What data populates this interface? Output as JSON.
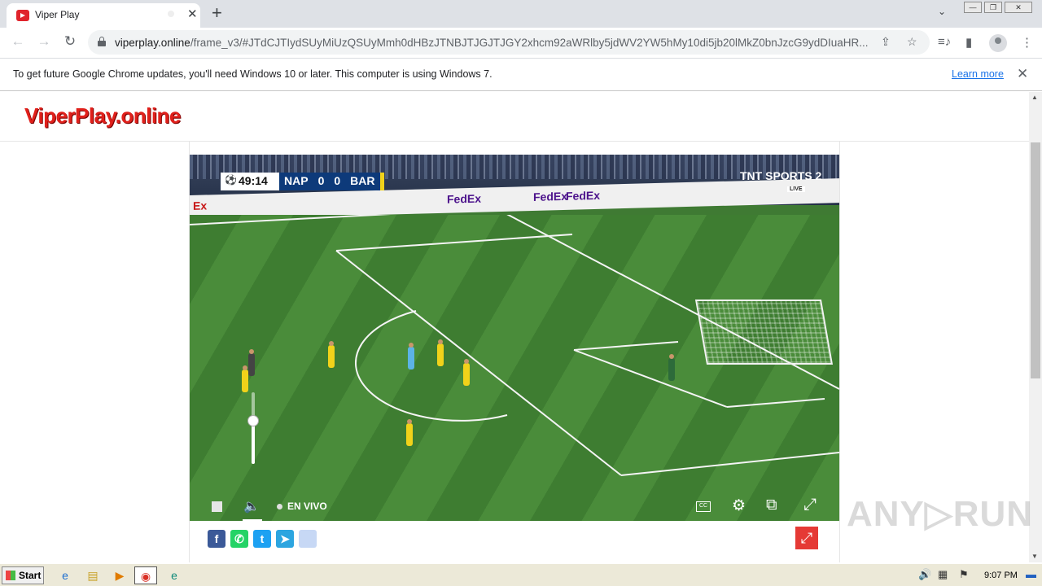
{
  "browser": {
    "tab_title": "Viper Play",
    "tab_close": "✕",
    "new_tab": "+",
    "url_host": "viperplay.online",
    "url_path": "/frame_v3/#JTdCJTIydSUyMiUzQSUyMmh0dHBzJTNBJTJGJTJGY2xhcm92aWRlby5jdWV2YW5hMy10di5jb20lMkZ0bnJzcG9ydDIuaHR...",
    "infobar_text": "To get future Google Chrome updates, you'll need Windows 10 or later. This computer is using Windows 7.",
    "infobar_link": "Learn more",
    "infobar_close": "✕",
    "back_icon": "←",
    "forward_icon": "→",
    "reload_icon": "↻",
    "share_icon": "⇪",
    "star_icon": "☆",
    "media_icon": "≡♪",
    "sidepanel_icon": "▮",
    "menu_icon": "⋮",
    "tab_search_icon": "⌄",
    "win_min": "—",
    "win_max": "❐",
    "win_close": "✕"
  },
  "site": {
    "logo": "ViperPlay.online"
  },
  "video": {
    "clock": "49:14",
    "home_team": "NAP",
    "home_score": "0",
    "away_score": "0",
    "away_team": "BAR",
    "channel": "TNT SPORTS 2",
    "channel_live": "LIVE",
    "board_fedex_1": "FedEx",
    "board_fedex_2": "FedEx",
    "board_fedex_3": "FedEx",
    "board_ex": "Ex",
    "volume_level": 0.6,
    "live_label": "EN VIVO",
    "cc_label": "CC",
    "speaker_icon": "🔈",
    "settings_icon": "⚙",
    "pip_icon": "⧉",
    "fullscreen_icon": "⤢"
  },
  "share": {
    "facebook": "f",
    "whatsapp": "✆",
    "twitter": "t",
    "telegram": "➤",
    "more": "",
    "fullscreen_red": "⤢"
  },
  "scroll": {
    "up": "▲",
    "down": "▼"
  },
  "watermark": "ANY▷RUN",
  "taskbar": {
    "start": "Start",
    "time": "9:07 PM",
    "ie_icon": "e",
    "explorer_icon": "▤",
    "media_icon": "▶",
    "chrome_icon": "◉",
    "edge_icon": "e",
    "speaker_icon": "🔊",
    "network_icon": "▦",
    "flag_icon": "⚑",
    "show_desktop_icon": "▬"
  },
  "colors": {
    "logo": "#e0201b",
    "team_bar": "#0d3a7a",
    "facebook": "#3b5998",
    "whatsapp": "#25d366",
    "twitter": "#1da1f2",
    "telegram": "#2ca5e0",
    "more": "#c7d8f5"
  }
}
